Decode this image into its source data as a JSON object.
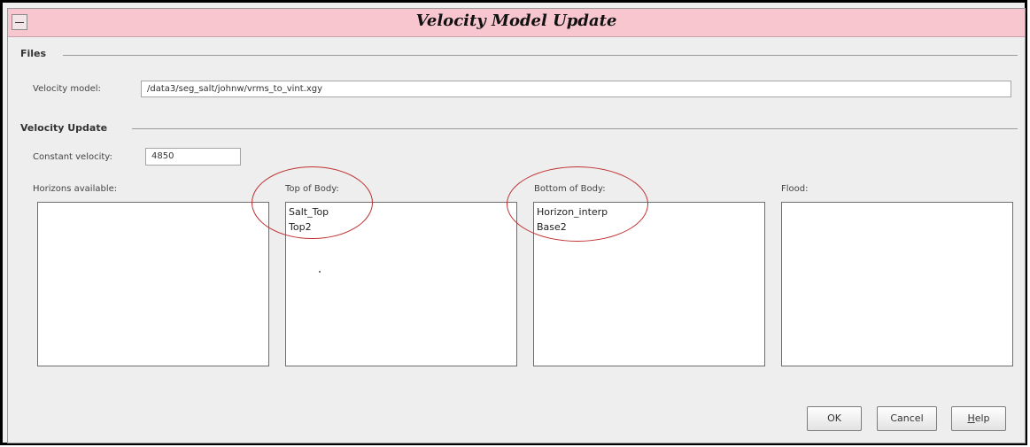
{
  "window": {
    "title": "Velocity Model Update"
  },
  "files": {
    "section_label": "Files",
    "velocity_model_label": "Velocity model:",
    "velocity_model_value": "/data3/seg_salt/johnw/vrms_to_vint.xgy"
  },
  "velocity_update": {
    "section_label": "Velocity Update",
    "constant_velocity_label": "Constant velocity:",
    "constant_velocity_value": "4850"
  },
  "lists": {
    "horizons_available": {
      "label": "Horizons available:",
      "items": []
    },
    "top_of_body": {
      "label": "Top of Body:",
      "items": [
        "Salt_Top",
        "Top2"
      ]
    },
    "bottom_of_body": {
      "label": "Bottom of Body:",
      "items": [
        "Horizon_interp",
        "Base2"
      ]
    },
    "flood": {
      "label": "Flood:",
      "items": []
    }
  },
  "buttons": {
    "ok": "OK",
    "cancel": "Cancel",
    "help": "Help"
  },
  "colors": {
    "title_bar": "#f7c6cf",
    "annotation_ellipse": "#c03030"
  }
}
